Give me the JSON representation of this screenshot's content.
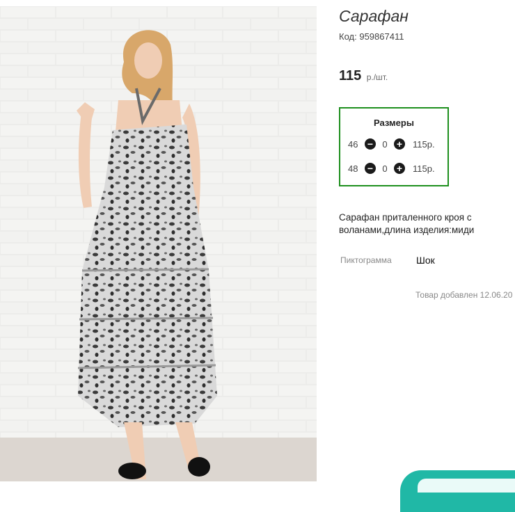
{
  "product": {
    "title": "Сарафан",
    "code_label": "Код:",
    "code": "959867411",
    "price": "115",
    "price_unit": "р./шт.",
    "description": "Сарафан приталенного кроя с воланами,длина изделия:миди",
    "properties": [
      {
        "label": "Пиктограмма",
        "value": "Шок"
      }
    ],
    "added_text": "Товар добавлен 12.06.20"
  },
  "sizes": {
    "title": "Размеры",
    "rows": [
      {
        "size": "46",
        "qty": "0",
        "price": "115р."
      },
      {
        "size": "48",
        "qty": "0",
        "price": "115р."
      }
    ]
  },
  "colors": {
    "sizes_border": "#1d8f1d",
    "chat_bubble": "#20b8a6"
  },
  "icons": {
    "minus": "minus-circle-icon",
    "plus": "plus-circle-icon"
  }
}
